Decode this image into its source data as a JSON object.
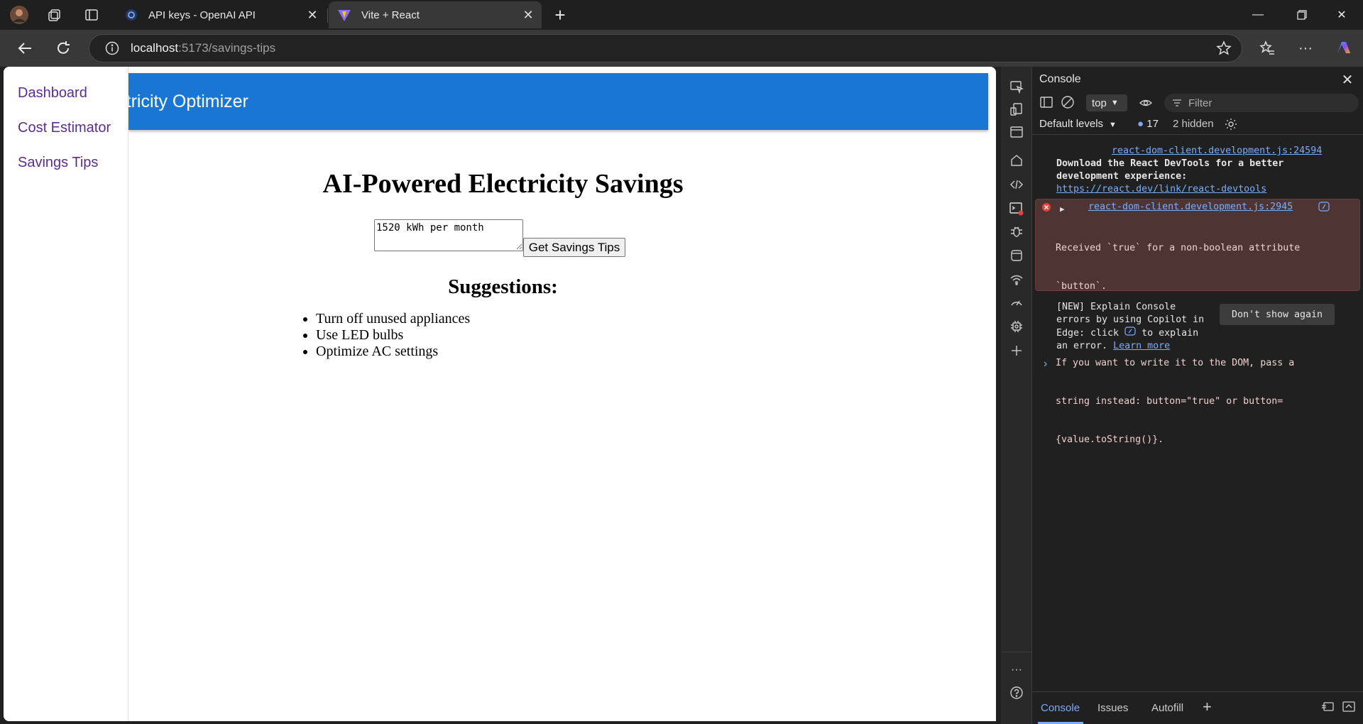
{
  "browser": {
    "tabs": [
      {
        "title": "API keys - OpenAI API",
        "active": false
      },
      {
        "title": "Vite + React",
        "active": true
      }
    ],
    "url_host": "localhost",
    "url_path": ":5173/savings-tips"
  },
  "page": {
    "sidebar_links": [
      "Dashboard",
      "Cost Estimator",
      "Savings Tips"
    ],
    "header_title": "Electricity Optimizer",
    "heading": "AI-Powered Electricity Savings",
    "input_value": "1520 kWh per month",
    "button_label": "Get Savings Tips",
    "suggestions_heading": "Suggestions:",
    "suggestions": [
      "Turn off unused appliances",
      "Use LED bulbs",
      "Optimize AC settings"
    ],
    "header_color": "#1976d2",
    "link_color": "#5b2c91"
  },
  "devtools": {
    "title": "Console",
    "context": "top",
    "filter_placeholder": "Filter",
    "levels": "Default levels",
    "message_count": "17",
    "hidden": "2 hidden",
    "log1_source": "react-dom-client.development.js:24594",
    "log1_line1": "Download the React DevTools for a better",
    "log1_line2": "development experience:",
    "log1_link": "https://react.dev/link/react-devtools",
    "error_source": "react-dom-client.development.js:2945",
    "error_lines": [
      "Received `true` for a non-boolean attribute",
      "`button`.",
      "",
      "If you want to write it to the DOM, pass a",
      "string instead: button=\"true\" or button=",
      "{value.toString()}."
    ],
    "copilot_lines": [
      "[NEW] Explain Console",
      "errors by using Copilot in",
      "Edge: click",
      "to explain",
      "an error."
    ],
    "learn_more": "Learn more",
    "dont_show": "Don't show again",
    "bottom_tabs": [
      "Console",
      "Issues",
      "Autofill"
    ]
  }
}
